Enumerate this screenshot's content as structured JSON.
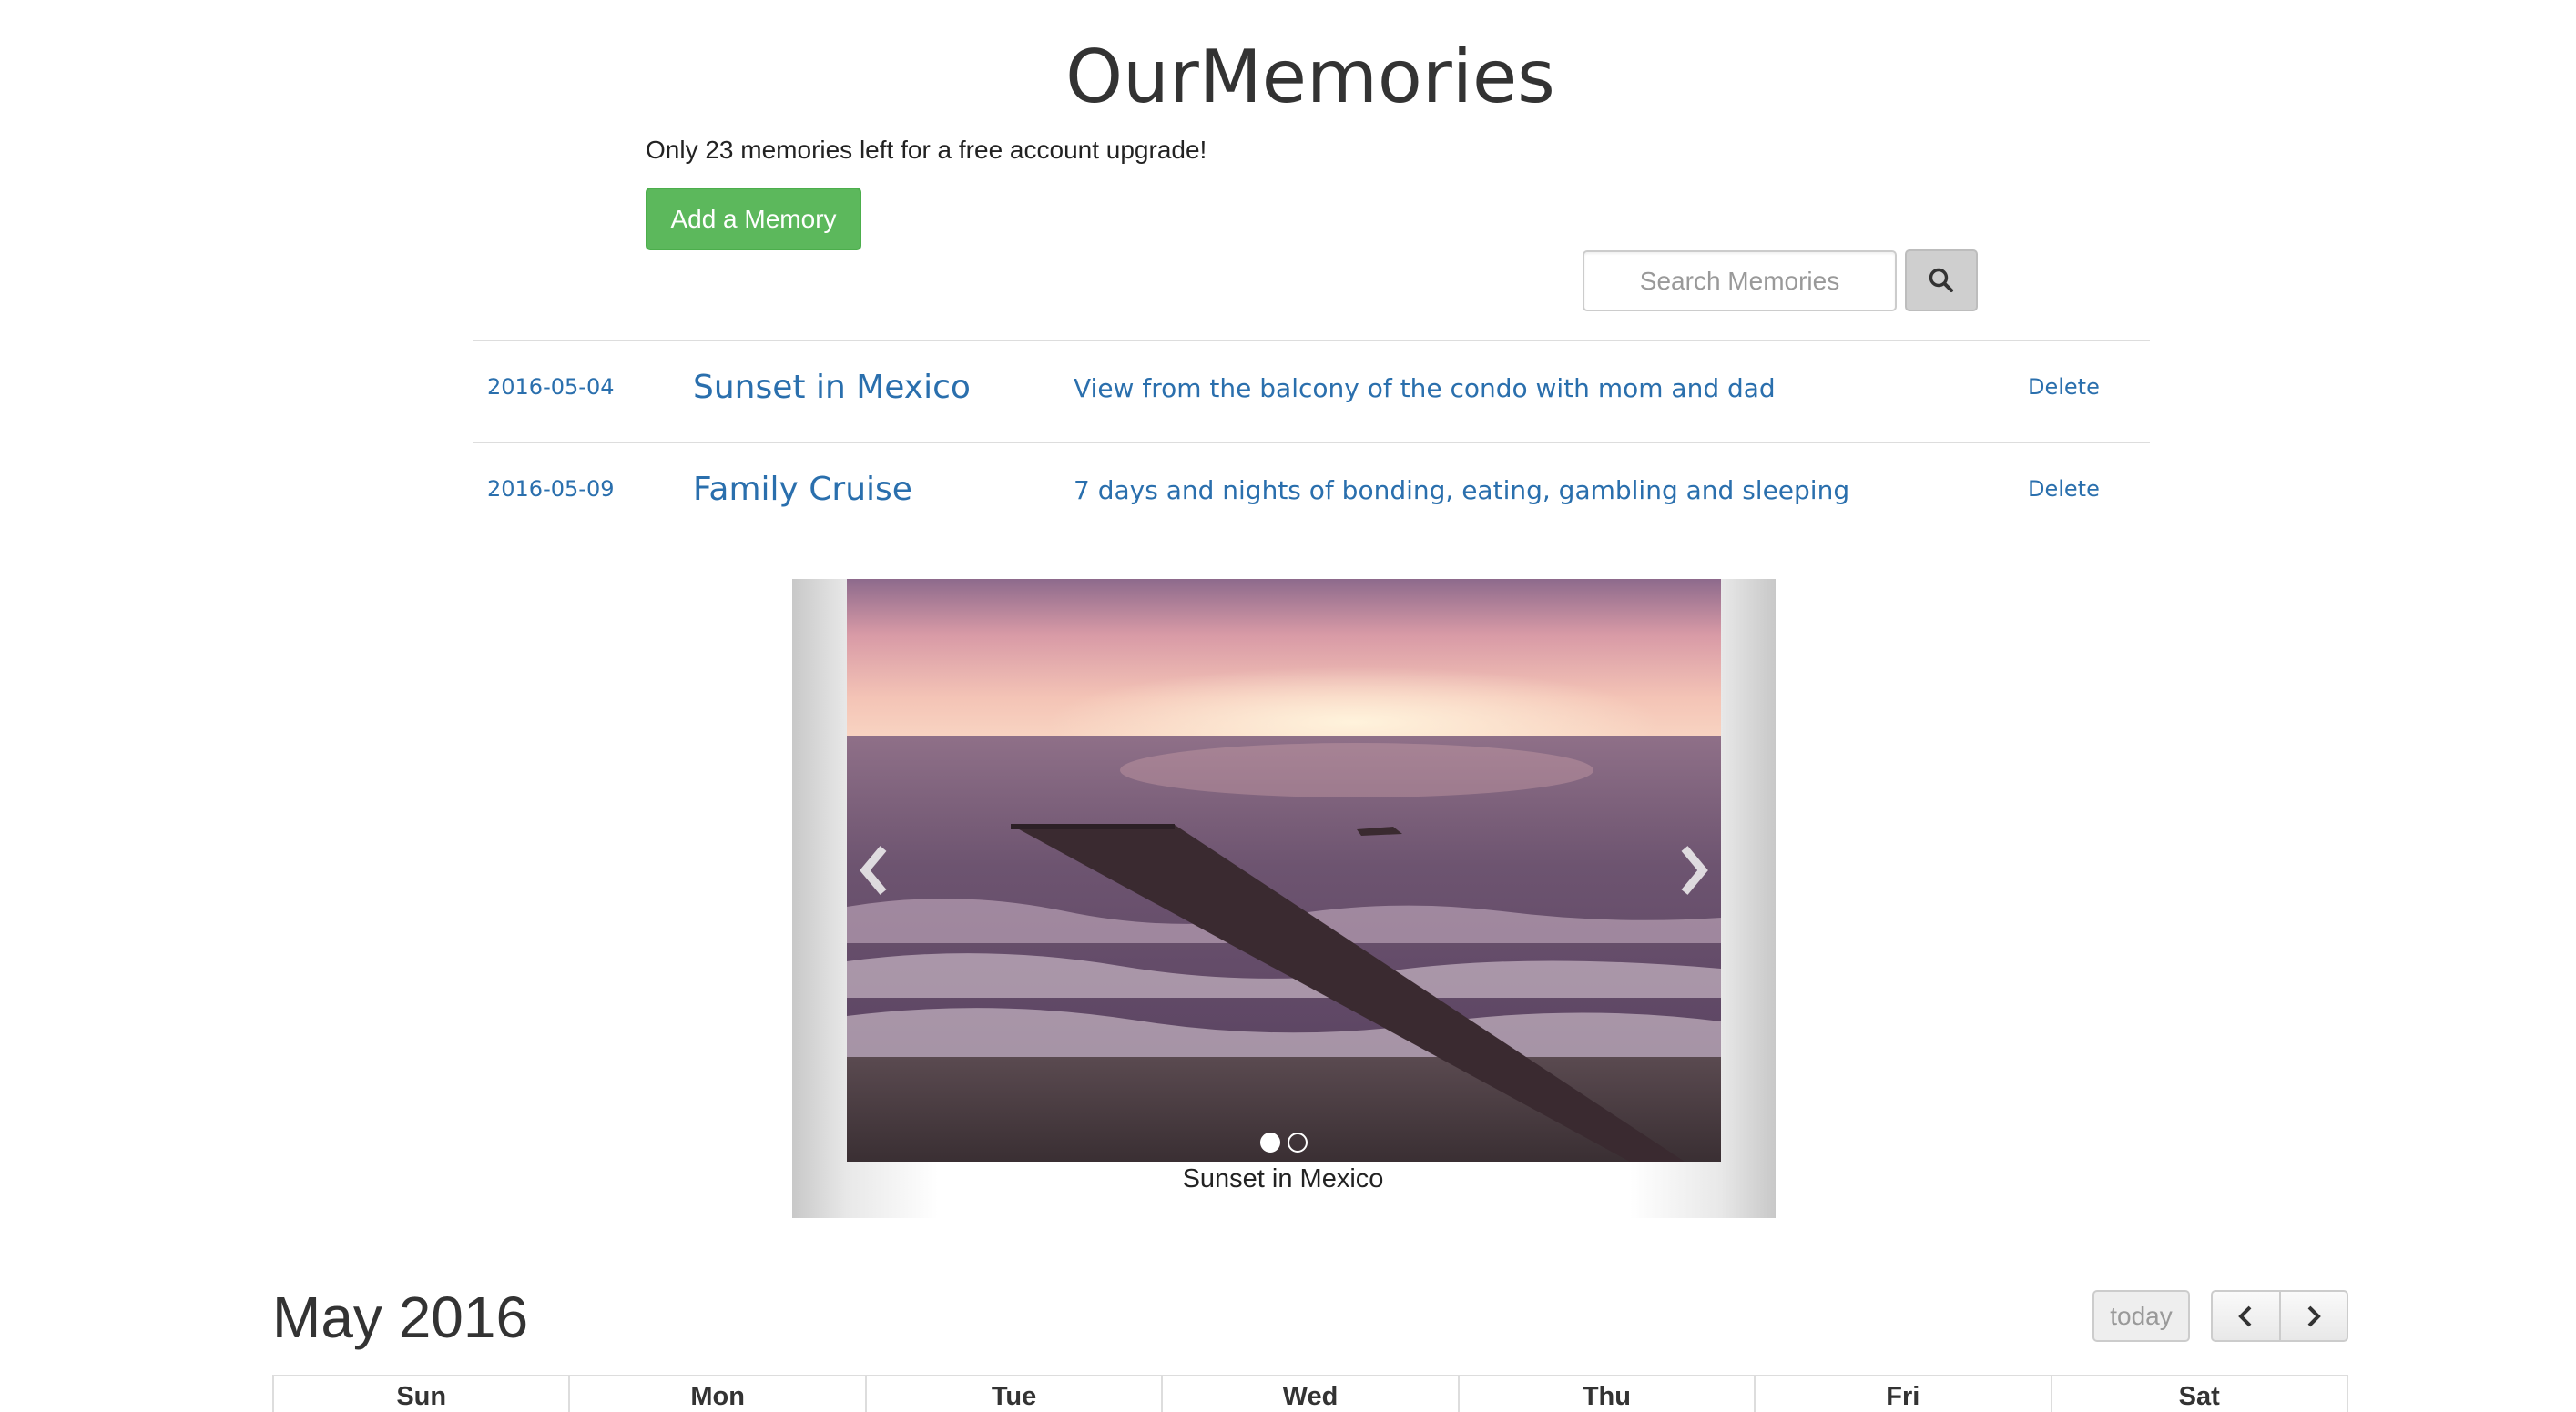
{
  "app": {
    "title": "OurMemories"
  },
  "header": {
    "upgrade_notice": "Only 23 memories left for a free account upgrade!",
    "add_button": "Add a Memory"
  },
  "search": {
    "placeholder": "Search Memories",
    "icon": "search-icon"
  },
  "memories": [
    {
      "date": "2016-05-04",
      "title": "Sunset in Mexico",
      "description": "View from the balcony of the condo with mom and dad",
      "delete_label": "Delete"
    },
    {
      "date": "2016-05-09",
      "title": "Family Cruise",
      "description": "7 days and nights of bonding, eating, gambling and sleeping",
      "delete_label": "Delete"
    }
  ],
  "carousel": {
    "caption": "Sunset in Mexico",
    "slide_count": 2,
    "active_slide": 1,
    "prev_icon": "chevron-left-icon",
    "next_icon": "chevron-right-icon"
  },
  "calendar": {
    "title": "May 2016",
    "today_label": "today",
    "weekdays": [
      "Sun",
      "Mon",
      "Tue",
      "Wed",
      "Thu",
      "Fri",
      "Sat"
    ]
  },
  "colors": {
    "link": "#2a6fad",
    "add_button": "#5cb85c",
    "search_button": "#cfcfcf"
  }
}
